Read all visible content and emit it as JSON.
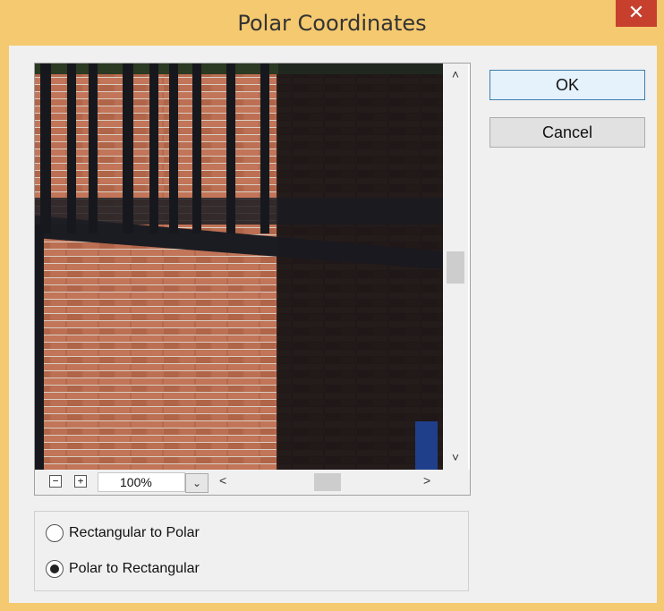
{
  "dialog": {
    "title": "Polar Coordinates",
    "close_icon": "✕"
  },
  "buttons": {
    "ok": "OK",
    "cancel": "Cancel"
  },
  "preview": {
    "zoom_value": "100%",
    "zoom_out_icon": "−",
    "zoom_in_icon": "+",
    "dropdown_icon": "⌄",
    "scroll_up": "˄",
    "scroll_down": "˅",
    "scroll_left": "<",
    "scroll_right": ">"
  },
  "options": {
    "items": [
      {
        "label": "Rectangular to Polar",
        "selected": false
      },
      {
        "label": "Polar to Rectangular",
        "selected": true
      }
    ]
  }
}
